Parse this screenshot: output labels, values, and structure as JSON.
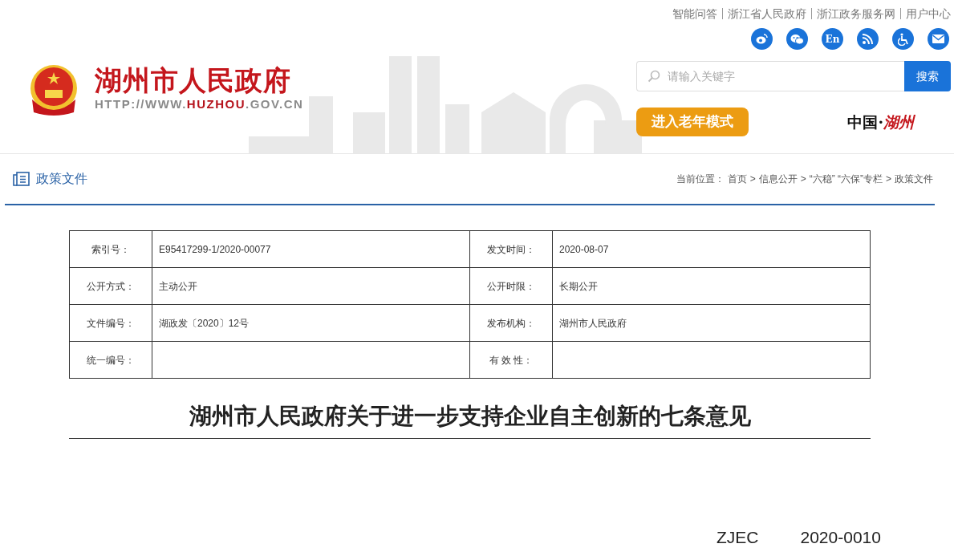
{
  "header": {
    "site_title": "湖州市人民政府",
    "site_url": {
      "prefix": "HTTP://WWW.",
      "highlight": "HUZHOU",
      "suffix": ".GOV.CN"
    },
    "top_links": [
      "智能问答",
      "浙江省人民政府",
      "浙江政务服务网",
      "用户中心"
    ],
    "social_icons": [
      {
        "kind": "weibo"
      },
      {
        "kind": "wechat"
      },
      {
        "kind": "english",
        "label": "En"
      },
      {
        "kind": "rss"
      },
      {
        "kind": "accessibility"
      },
      {
        "kind": "mail"
      }
    ],
    "search": {
      "placeholder": "请输入关键字",
      "button": "搜索"
    },
    "elder_mode_button": "进入老年模式",
    "slogan": {
      "prefix": "中国·",
      "highlight": "湖州"
    }
  },
  "section": {
    "title": "政策文件",
    "breadcrumb": {
      "label": "当前位置：",
      "separator": ">",
      "items": [
        "首页",
        "信息公开",
        "“六稳” “六保”专栏",
        "政策文件"
      ]
    }
  },
  "meta_table": {
    "rows": [
      [
        {
          "label": "索引号：",
          "value": "E95417299-1/2020-00077"
        },
        {
          "label": "发文时间：",
          "value": "2020-08-07"
        }
      ],
      [
        {
          "label": "公开方式：",
          "value": "主动公开"
        },
        {
          "label": "公开时限：",
          "value": "长期公开"
        }
      ],
      [
        {
          "label": "文件编号：",
          "value": "湖政发〔2020〕12号"
        },
        {
          "label": "发布机构：",
          "value": "湖州市人民政府"
        }
      ],
      [
        {
          "label": "统一编号："
        },
        {
          "label": "有 效 性："
        }
      ]
    ]
  },
  "document_title": "湖州市人民政府关于进一步支持企业自主创新的七条意见",
  "document_code": [
    "ZJEC",
    "2020-0010"
  ]
}
